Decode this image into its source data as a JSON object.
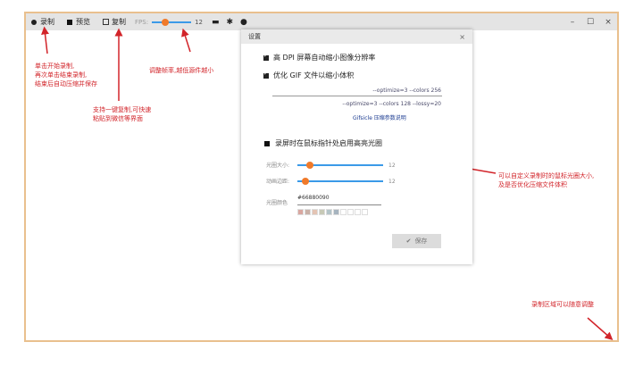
{
  "toolbar": {
    "record_label": "录制",
    "preview_label": "预览",
    "copy_label": "复制",
    "fps_label": "FPS:",
    "fps_value": "12",
    "fps_fraction": 0.3,
    "folder_icon": "folder-icon",
    "settings_icon": "gear-icon",
    "github_icon": "github-icon"
  },
  "window_controls": {
    "minimize": "–",
    "maximize": "☐",
    "close": "×"
  },
  "notes": {
    "record_line1": "单击开始录制,",
    "record_line2": "再次单击结束录制,",
    "record_line3": "结束后自动压缩并保存",
    "copy_line1": "支持一键复制,可快速",
    "copy_line2": "粘贴到微信等界面",
    "fps_note": "调整帧率,越低源件越小",
    "cursor_line1": "可以自定义录制时的鼠标光圈大小,",
    "cursor_line2": "及是否优化压缩文件体积",
    "resize_note": "录制区域可以随意调整"
  },
  "settings": {
    "title": "设置",
    "close": "×",
    "hidpi_label": "高 DPI 屏幕自动缩小图像分辨率",
    "optimize_label": "优化 GIF 文件以缩小体积",
    "opt_args_1": "--optimize=3 --colors 256",
    "opt_args_2": "--optimize=3 --colors 128 --lossy=20",
    "gifsicle_link": "Gifsicle 压缩参数说明",
    "highlight_label": "录屏时在鼠标指针处启用高亮光圈",
    "halo_size_label": "光圈大小:",
    "halo_size_value": "12",
    "anim_margin_label": "动画边距:",
    "anim_margin_value": "12",
    "halo_color_label": "光圈颜色",
    "halo_color_value": "#66880090",
    "swatches": [
      "#d9a7a0",
      "#c9b1a8",
      "#e4c4b4",
      "#c7c9b6",
      "#b3c4c8",
      "#a6b4bf",
      "#ffffff",
      "#ffffff",
      "#ffffff",
      "#ffffff"
    ],
    "save_label": "保存"
  }
}
